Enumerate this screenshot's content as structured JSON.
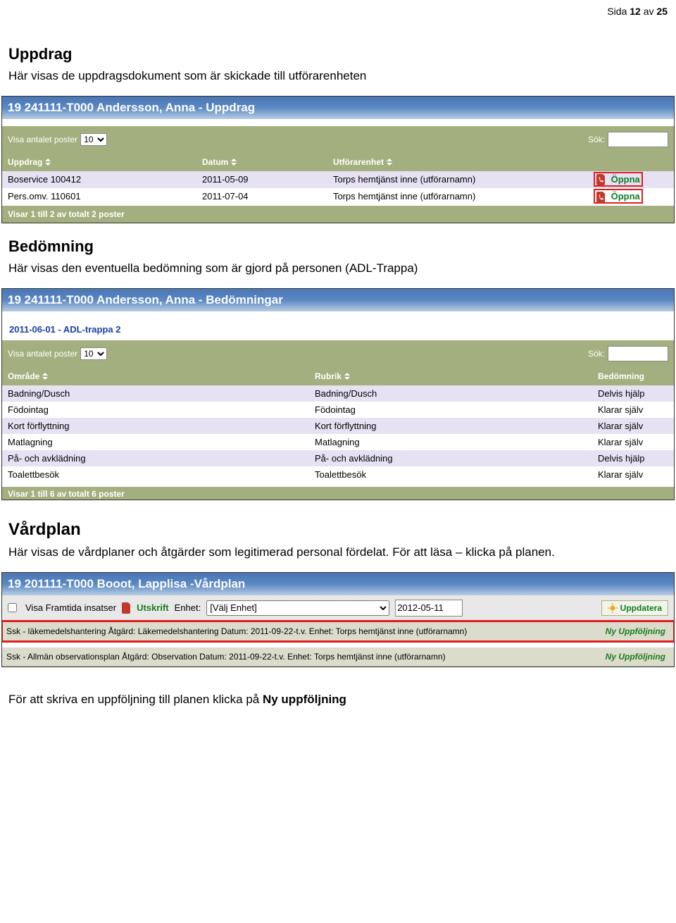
{
  "page_number": {
    "prefix": "Sida ",
    "current": "12",
    "mid": " av ",
    "total": "25"
  },
  "uppdrag": {
    "heading": "Uppdrag",
    "text": "Här visas de uppdragsdokument som är skickade till utförarenheten",
    "title": "19 241111-T000 Andersson, Anna - Uppdrag",
    "visa_label": "Visa antalet poster",
    "visa_value": "10",
    "sok_label": "Sök:",
    "headers": {
      "uppdrag": "Uppdrag",
      "datum": "Datum",
      "utforarenhet": "Utförarenhet"
    },
    "rows": [
      {
        "uppdrag": "Boservice 100412",
        "datum": "2011-05-09",
        "enhet": "Torps hemtjänst inne (utförarnamn)",
        "open": "Öppna"
      },
      {
        "uppdrag": "Pers.omv. 110601",
        "datum": "2011-07-04",
        "enhet": "Torps hemtjänst inne (utförarnamn)",
        "open": "Öppna"
      }
    ],
    "status": "Visar 1 till 2 av totalt 2 poster"
  },
  "bedomning": {
    "heading": "Bedömning",
    "text": "Här visas den eventuella bedömning som är gjord på personen (ADL-Trappa)",
    "title": "19 241111-T000 Andersson, Anna - Bedömningar",
    "date_head": "2011-06-01  -   ADL-trappa 2",
    "visa_label": "Visa antalet poster",
    "visa_value": "10",
    "sok_label": "Sök:",
    "headers": {
      "omrade": "Område",
      "rubrik": "Rubrik",
      "bed": "Bedömning"
    },
    "rows": [
      {
        "omrade": "Badning/Dusch",
        "rubrik": "Badning/Dusch",
        "bed": "Delvis hjälp"
      },
      {
        "omrade": "Födointag",
        "rubrik": "Födointag",
        "bed": "Klarar själv"
      },
      {
        "omrade": "Kort förflyttning",
        "rubrik": "Kort förflyttning",
        "bed": "Klarar själv"
      },
      {
        "omrade": "Matlagning",
        "rubrik": "Matlagning",
        "bed": "Klarar själv"
      },
      {
        "omrade": "På- och avklädning",
        "rubrik": "På- och avklädning",
        "bed": "Delvis hjälp"
      },
      {
        "omrade": "Toalettbesök",
        "rubrik": "Toalettbesök",
        "bed": "Klarar själv"
      }
    ],
    "status": "Visar 1 till 6 av totalt 6 poster"
  },
  "vardplan": {
    "heading": "Vårdplan",
    "text": "Här visas de vårdplaner och åtgärder som legitimerad personal fördelat. För att läsa – klicka på planen.",
    "title": "19 201111-T000 Booot, Lapplisa -Vårdplan",
    "toolbar": {
      "checkbox_label": "Visa Framtida insatser",
      "utskrift": "Utskrift",
      "enhet_label": "Enhet:",
      "enhet_value": "[Välj Enhet]",
      "date": "2012-05-11",
      "uppdatera": "Uppdatera"
    },
    "rows": [
      {
        "text": "Ssk - läkemedelshantering Åtgärd: Läkemedelshantering   Datum: 2011-09-22-t.v.   Enhet: Torps hemtjänst inne (utförarnamn)",
        "link": "Ny Uppföljning",
        "hl": true
      },
      {
        "text": "Ssk - Allmän observationsplan Åtgärd: Observation   Datum: 2011-09-22-t.v.   Enhet: Torps hemtjänst inne (utförarnamn)",
        "link": "Ny Uppföljning",
        "hl": false
      }
    ],
    "footer_text": "För att skriva en uppföljning till planen klicka på ",
    "footer_bold": "Ny uppföljning"
  }
}
